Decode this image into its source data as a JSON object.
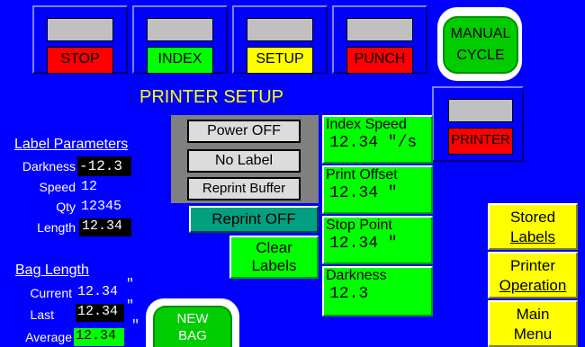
{
  "mode_buttons": [
    {
      "label": "STOP",
      "color": "#ff0000"
    },
    {
      "label": "INDEX",
      "color": "#00ff00"
    },
    {
      "label": "SETUP",
      "color": "#ffff00"
    },
    {
      "label": "PUNCH",
      "color": "#ff0000"
    }
  ],
  "manual_cycle": {
    "line1": "MANUAL",
    "line2": "CYCLE"
  },
  "printer_indicator": {
    "label": "PRINTER",
    "color": "#ff0000"
  },
  "page_title": "PRINTER SETUP",
  "label_parameters": {
    "heading": "Label Parameters",
    "darkness_label": "Darkness",
    "darkness_value": "-12.3",
    "speed_label": "Speed",
    "speed_value": "12",
    "qty_label": "Qty",
    "qty_value": "12345",
    "length_label": "Length",
    "length_value": "12.34"
  },
  "bag_length": {
    "heading": "Bag Length",
    "current_label": "Current",
    "current_value": "12.34",
    "last_label": "Last",
    "last_value": "12.34",
    "average_label": "Average",
    "average_value": "12.34",
    "unit": "\""
  },
  "printer_controls": {
    "power": "Power OFF",
    "no_label": "No Label",
    "reprint_buffer": "Reprint Buffer",
    "reprint": "Reprint OFF",
    "clear_line1": "Clear",
    "clear_line2": "Labels"
  },
  "settings": {
    "index_speed_label": "Index Speed",
    "index_speed_value": "12.34 \"/s",
    "print_offset_label": "Print Offset",
    "print_offset_value": "12.34 \"",
    "stop_point_label": "Stop Point",
    "stop_point_value": "12.34 \"",
    "darkness_label": "Darkness",
    "darkness_value": "12.3"
  },
  "new_bag": {
    "line1": "NEW",
    "line2": "BAG"
  },
  "nav": {
    "stored_1": "Stored",
    "stored_2": "Labels",
    "printer_1": "Printer",
    "printer_2": "Operation",
    "main_1": "Main",
    "main_2": "Menu"
  },
  "colors": {
    "background": "#0000ff",
    "green": "#00ff00",
    "yellow": "#ffff00",
    "red": "#ff0000",
    "teal": "#00a080"
  }
}
